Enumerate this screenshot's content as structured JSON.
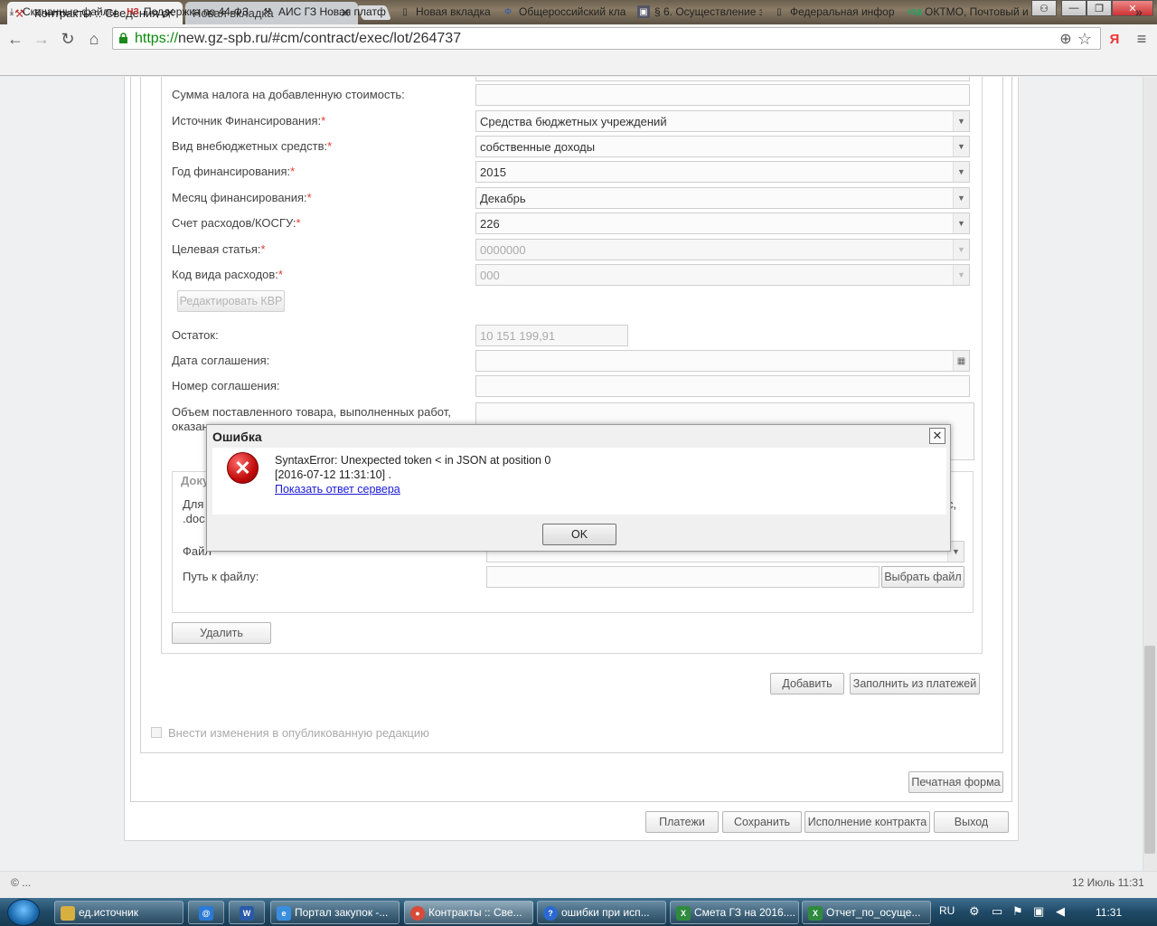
{
  "browser": {
    "tabs": [
      {
        "title": "Контракты :: Сведения о",
        "close": "✕",
        "active": true
      },
      {
        "title": "Новая вкладка",
        "close": "✕",
        "active": false
      }
    ],
    "window_controls": {
      "user": "⚇",
      "minimize": "—",
      "maximize": "❐",
      "close": "✕"
    },
    "url_scheme": "https://",
    "url_rest": "new.gz-spb.ru/#cm/contract/exec/lot/264737",
    "bookmarks": [
      {
        "label": "Скачанные файлы",
        "icon": "download-icon"
      },
      {
        "label": "Поддержка по 44-ФЗ",
        "icon": "nauz-icon"
      },
      {
        "label": "АИС ГЗ Новая платф",
        "icon": "gavel-icon"
      },
      {
        "label": "Новая вкладка",
        "icon": "page-icon"
      },
      {
        "label": "Общероссийский кла",
        "icon": "phi-icon"
      },
      {
        "label": "§ 6. Осуществление з",
        "icon": "book-icon"
      },
      {
        "label": "Федеральная инфор",
        "icon": "page-icon"
      },
      {
        "label": "ОКТМО, Почтовый и",
        "icon": "kod-icon"
      }
    ],
    "bookmarks_more": "»",
    "yandex": "Я",
    "menu": "≡"
  },
  "form": {
    "vat_label": "Сумма налога на добавленную стоимость:",
    "source_label": "Источник Финансирования:",
    "source_value": "Средства бюджетных учреждений",
    "extrabudget_label": "Вид внебюджетных средств:",
    "extrabudget_value": "собственные доходы",
    "year_label": "Год финансирования:",
    "year_value": "2015",
    "month_label": "Месяц финансирования:",
    "month_value": "Декабрь",
    "account_label": "Счет расходов/КОСГУ:",
    "account_value": "226",
    "target_label": "Целевая статья:",
    "target_value": "0000000",
    "kvr_label": "Код вида расходов:",
    "kvr_value": "000",
    "edit_kvr_button": "Редактировать КВР",
    "remainder_label": "Остаток:",
    "remainder_value": "10 151 199,91",
    "agreement_date_label": "Дата соглашения:",
    "agreement_number_label": "Номер соглашения:",
    "volume_label_1": "Объем поставленного товара, выполненных работ,",
    "volume_label_2": "оказан",
    "required_mark": "*"
  },
  "documents": {
    "legend": "Доку",
    "hint_start": "Для",
    "hint_start_2": ".doc",
    "hint_end": "c,",
    "file_label": "Файл",
    "path_label": "Путь к файлу:",
    "choose_button": "Выбрать файл",
    "delete_button": "Удалить"
  },
  "actions": {
    "add_button": "Добавить",
    "fill_button": "Заполнить из платежей",
    "publish_checkbox_label": "Внести изменения в опубликованную редакцию",
    "print_button": "Печатная форма",
    "payments_button": "Платежи",
    "save_button": "Сохранить",
    "execution_button": "Исполнение контракта",
    "exit_button": "Выход"
  },
  "footer": {
    "copyright": "© ...",
    "datetime": "12 Июль 11:31"
  },
  "dialog": {
    "title": "Ошибка",
    "close": "✕",
    "error_icon": "✕",
    "message": "SyntaxError: Unexpected token < in JSON at position 0",
    "timestamp": "[2016-07-12 11:31:10] .",
    "link": "Показать ответ сервера",
    "ok_button": "OK"
  },
  "taskbar": {
    "items": [
      {
        "label": "ед.источник",
        "icon": "folder-icon",
        "color": "#d8b040"
      },
      {
        "label": "",
        "icon": "outlook-icon",
        "color": "#2a7bd6"
      },
      {
        "label": "",
        "icon": "word-icon",
        "color": "#2a5aa8"
      },
      {
        "label": "Портал закупок -...",
        "icon": "ie-icon",
        "color": "#3a8ee0"
      },
      {
        "label": "Контракты :: Све...",
        "icon": "chrome-icon",
        "color": "#d84a3a"
      },
      {
        "label": "ошибки при исп...",
        "icon": "help-icon",
        "color": "#2a6ad0"
      },
      {
        "label": "Смета ГЗ на 2016....",
        "icon": "excel-icon",
        "color": "#2f8a3e"
      },
      {
        "label": "Отчет_по_осуще...",
        "icon": "excel-icon",
        "color": "#2f8a3e"
      }
    ],
    "lang": "RU",
    "time": "11:31"
  }
}
